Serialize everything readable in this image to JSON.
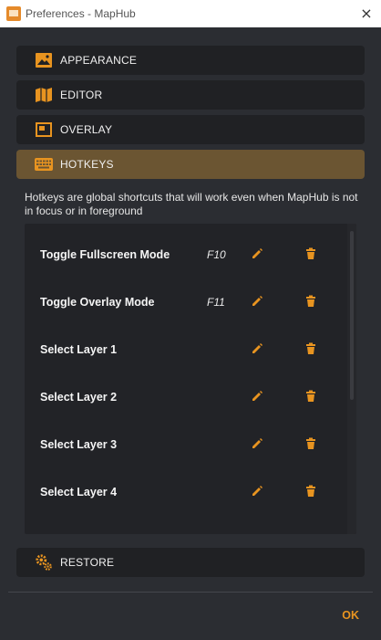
{
  "window": {
    "title": "Preferences - MapHub",
    "close_glyph": "×"
  },
  "sections": [
    {
      "label": "APPEARANCE",
      "icon": "image-icon"
    },
    {
      "label": "EDITOR",
      "icon": "map-icon"
    },
    {
      "label": "OVERLAY",
      "icon": "overlay-window-icon"
    },
    {
      "label": "HOTKEYS",
      "icon": "keyboard-icon",
      "active": true
    }
  ],
  "hotkeys": {
    "description": "Hotkeys are global shortcuts that will work even when MapHub is not in focus or in foreground",
    "rows": [
      {
        "name": "Toggle Fullscreen Mode",
        "key": "F10"
      },
      {
        "name": "Toggle Overlay Mode",
        "key": "F11"
      },
      {
        "name": "Select Layer 1",
        "key": ""
      },
      {
        "name": "Select Layer 2",
        "key": ""
      },
      {
        "name": "Select Layer 3",
        "key": ""
      },
      {
        "name": "Select Layer 4",
        "key": ""
      }
    ]
  },
  "restore": {
    "label": "RESTORE",
    "icon": "gears-icon"
  },
  "footer": {
    "ok_label": "OK"
  },
  "colors": {
    "accent": "#e89420",
    "active_section": "#6b5532",
    "background": "#2b2d32"
  }
}
